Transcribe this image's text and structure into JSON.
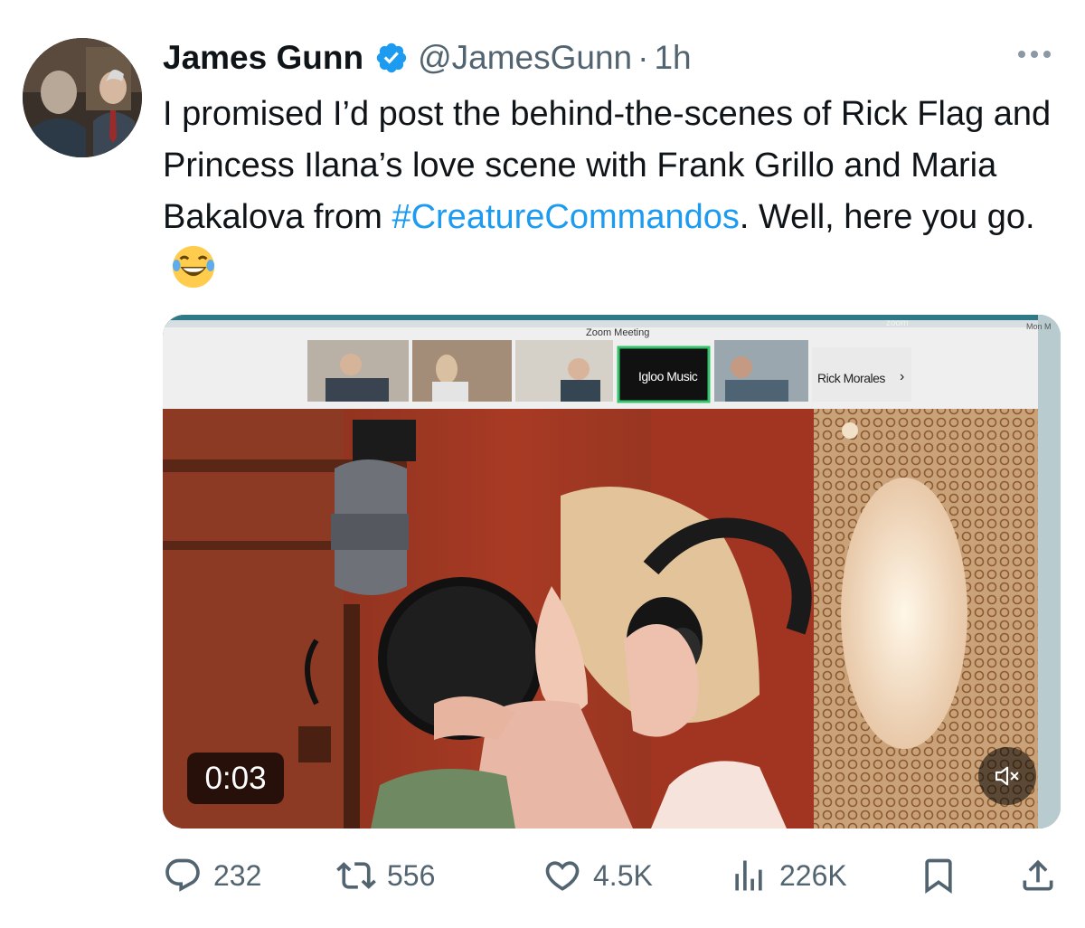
{
  "tweet": {
    "author": {
      "name": "James Gunn",
      "handle": "@JamesGunn",
      "separator": "·",
      "time": "1h",
      "verified": true
    },
    "text_before": "I promised I’d post the behind-the-scenes of Rick Flag and Princess Ilana’s love scene with Frank Grillo and Maria Bakalova from ",
    "hashtag": "#CreatureCommandos",
    "text_after": ". Well, here you go.",
    "emoji": "face-with-tears-of-joy",
    "media": {
      "type": "video",
      "duration": "0:03",
      "muted": true,
      "zoom_window_title": "Zoom Meeting",
      "menubar_app": "zoom",
      "menubar_right": "Mon M",
      "participant_tiles": [
        "Igloo Music",
        "Rick Morales"
      ],
      "next_arrow": "›"
    },
    "metrics": {
      "replies": "232",
      "reposts": "556",
      "likes": "4.5K",
      "views": "226K"
    }
  },
  "colors": {
    "link": "#1d9bf0",
    "secondary_text": "#536471",
    "text": "#0f1419",
    "verified_badge": "#1d9bf0"
  },
  "icons": [
    "more-icon",
    "verified-icon",
    "reply-icon",
    "repost-icon",
    "like-icon",
    "views-icon",
    "bookmark-icon",
    "share-icon",
    "mute-icon"
  ]
}
